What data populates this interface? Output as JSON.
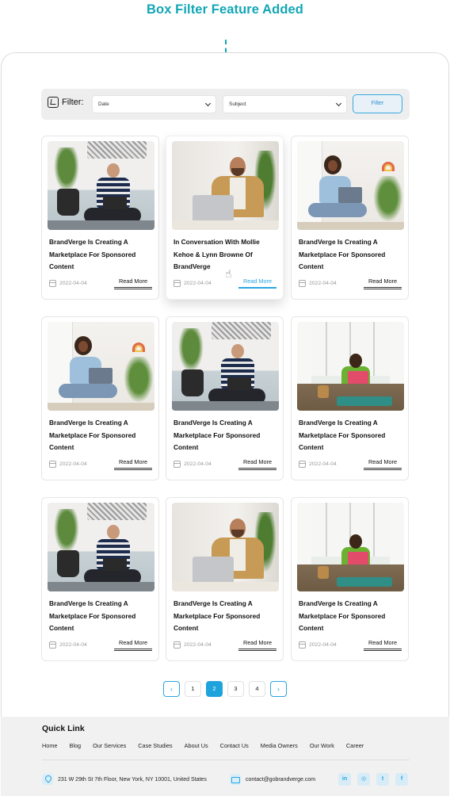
{
  "annotation": {
    "title": "Box Filter Feature Added"
  },
  "filter": {
    "label": "Filter:",
    "date_placeholder": "Date",
    "subject_placeholder": "Subject",
    "button_label": "Filter"
  },
  "cards": [
    {
      "title": "BrandVerge Is Creating A Marketplace For Sponsored Content",
      "date": "2022-04-04",
      "read_more": "Read More"
    },
    {
      "title": "In Conversation With Mollie Kehoe & Lynn Browne Of BrandVerge",
      "date": "2022-04-04",
      "read_more": "Read More"
    },
    {
      "title": "BrandVerge Is Creating A Marketplace For Sponsored Content",
      "date": "2022-04-04",
      "read_more": "Read More"
    },
    {
      "title": "BrandVerge Is Creating A Marketplace For Sponsored Content",
      "date": "2022-04-04",
      "read_more": "Read More"
    },
    {
      "title": "BrandVerge Is Creating A Marketplace For Sponsored Content",
      "date": "2022-04-04",
      "read_more": "Read More"
    },
    {
      "title": "BrandVerge Is Creating A Marketplace For Sponsored Content",
      "date": "2022-04-04",
      "read_more": "Read More"
    },
    {
      "title": "BrandVerge Is Creating A Marketplace For Sponsored Content",
      "date": "2022-04-04",
      "read_more": "Read More"
    },
    {
      "title": "BrandVerge Is Creating A Marketplace For Sponsored Content",
      "date": "2022-04-04",
      "read_more": "Read More"
    },
    {
      "title": "BrandVerge Is Creating A Marketplace For Sponsored Content",
      "date": "2022-04-04",
      "read_more": "Read More"
    }
  ],
  "pagination": {
    "prev": "‹",
    "pages": [
      "1",
      "2",
      "3",
      "4"
    ],
    "current": "2",
    "next": "›"
  },
  "footer": {
    "quick_link_title": "Quick Link",
    "links": [
      "Home",
      "Blog",
      "Our Services",
      "Case Studies",
      "About Us",
      "Contact Us",
      "Media Owners",
      "Our Work",
      "Career"
    ],
    "address": "231 W 29th St 7th Floor, New York, NY 10001, United States",
    "email": "contact@gobrandverge.com",
    "socials": [
      "in",
      "◎",
      "t",
      "f"
    ]
  },
  "colors": {
    "accent": "#2aa6df",
    "annotation": "#12a6b5"
  },
  "icons": [
    "filter-icon",
    "chevron-down-icon",
    "calendar-icon",
    "pointer-hand-icon",
    "chevron-left-icon",
    "chevron-right-icon",
    "location-pin-icon",
    "mail-icon",
    "linkedin-icon",
    "instagram-icon",
    "twitter-icon",
    "facebook-icon"
  ]
}
